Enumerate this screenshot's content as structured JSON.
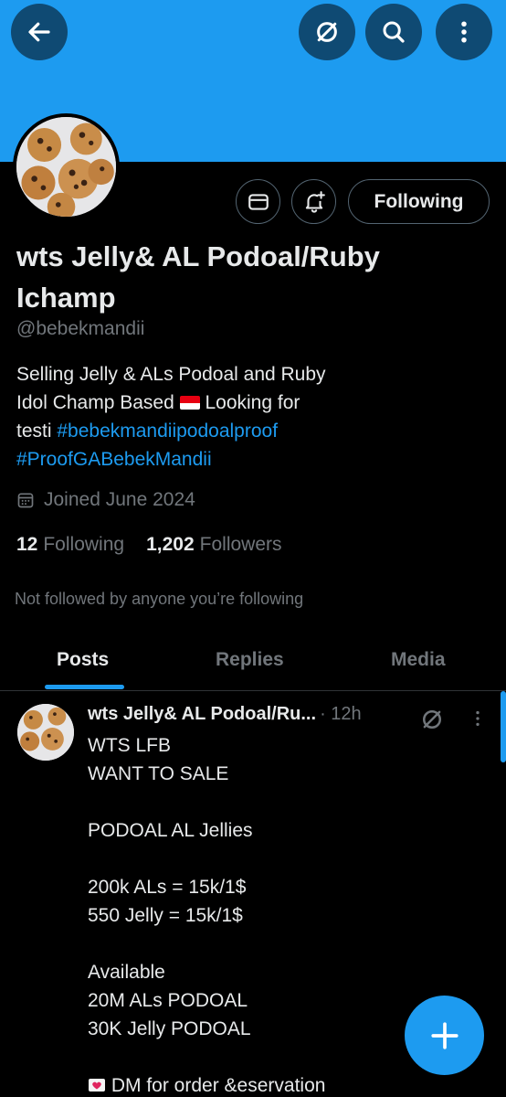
{
  "header": {
    "back_icon": "arrow-left-icon",
    "grok_icon": "grok-icon",
    "search_icon": "search-icon",
    "more_icon": "more-vertical-icon",
    "banner_color": "#1d9bf0"
  },
  "profile": {
    "name_line1": "wts Jelly& AL Podoal/Ruby",
    "name_line2": "Ichamp",
    "handle": "@bebekmandii",
    "bio_line1": "Selling Jelly & ALs Podoal and Ruby",
    "bio_line2a": "Idol Champ Based",
    "bio_line2b": "Looking for",
    "bio_line3a": "testi",
    "bio_tag1": "#bebekmandiipodoalproof",
    "bio_tag2": "#ProofGABebekMandii",
    "joined": "Joined June 2024",
    "following_count": "12",
    "following_label": "Following",
    "followers_count": "1,202",
    "followers_label": "Followers",
    "not_followed": "Not followed by anyone you’re following"
  },
  "actions": {
    "message_icon": "envelope-icon",
    "notify_icon": "bell-plus-icon",
    "following_button": "Following"
  },
  "tabs": [
    {
      "label": "Posts",
      "active": true
    },
    {
      "label": "Replies",
      "active": false
    },
    {
      "label": "Media",
      "active": false
    }
  ],
  "post": {
    "author": "wts Jelly& AL Podoal/Ru...",
    "time": "· 12h",
    "lines": [
      "WTS LFB",
      "WANT TO SALE",
      "",
      "PODOAL AL Jellies",
      "",
      "200k ALs = 15k/1$",
      "550 Jelly = 15k/1$",
      "",
      "Available",
      "20M ALs PODOAL",
      "30K Jelly PODOAL",
      ""
    ],
    "last_line": "DM for order &eservation"
  },
  "fab": {
    "icon": "plus-icon"
  }
}
